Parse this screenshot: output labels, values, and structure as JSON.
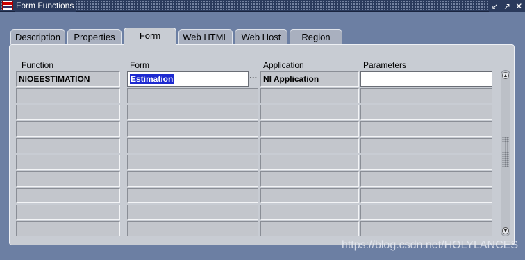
{
  "window": {
    "title": "Form Functions",
    "app_icon": "oracle-app-icon",
    "controls": [
      {
        "name": "minimize-icon",
        "glyph": "↙"
      },
      {
        "name": "maximize-icon",
        "glyph": "↗"
      },
      {
        "name": "close-icon",
        "glyph": "✕"
      }
    ]
  },
  "tabs": [
    {
      "label": "Description"
    },
    {
      "label": "Properties"
    },
    {
      "label": "Form",
      "active": true
    },
    {
      "label": "Web HTML"
    },
    {
      "label": "Web Host"
    },
    {
      "label": "Region"
    }
  ],
  "grid": {
    "headers": {
      "function": "Function",
      "form": "Form",
      "application": "Application",
      "parameters": "Parameters"
    },
    "rows": [
      {
        "function": "NIOEESTIMATION",
        "form": "Estimation",
        "application": "NI Application",
        "parameters": ""
      }
    ],
    "empty_row_count": 9,
    "lov_button": "···"
  },
  "scrollbar": {
    "up_icon": "▲",
    "down_icon": "▼"
  },
  "watermark": "https://blog.csdn.net/HOLYLANCES",
  "colors": {
    "background": "#6c7fa3",
    "panel": "#c8ccd3",
    "selection": "#1d2ad1",
    "titlebar": "#2a3a5c"
  }
}
